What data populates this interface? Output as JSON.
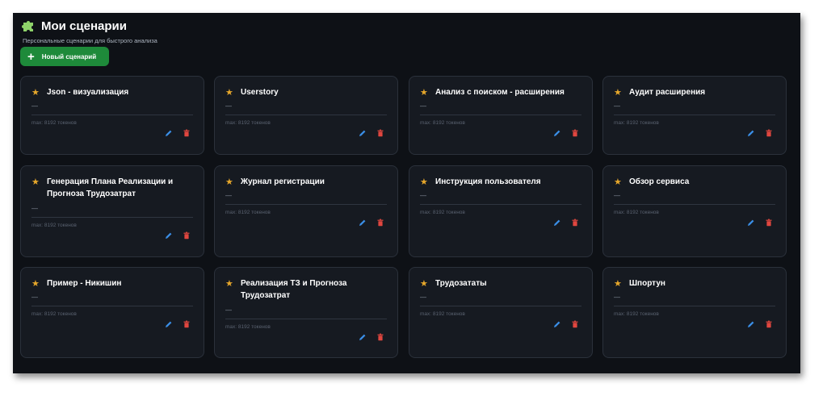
{
  "header": {
    "title": "Мои сценарии",
    "subtitle": "Персональные сценарии для быстрого анализа",
    "new_button_label": "Новый сценарий"
  },
  "cards": [
    {
      "title": "Json - визуализация",
      "description": "—",
      "meta": "max: 8192 токенов"
    },
    {
      "title": "Userstory",
      "description": "—",
      "meta": "max: 8192 токенов"
    },
    {
      "title": "Анализ с поиском - расширения",
      "description": "—",
      "meta": "max: 8192 токенов"
    },
    {
      "title": "Аудит расширения",
      "description": "—",
      "meta": "max: 8192 токенов"
    },
    {
      "title": "Генерация Плана Реализации и Прогноза Трудозатрат",
      "description": "—",
      "meta": "max: 8192 токенов"
    },
    {
      "title": "Журнал регистрации",
      "description": "—",
      "meta": "max: 8192 токенов"
    },
    {
      "title": "Инструкция пользователя",
      "description": "—",
      "meta": "max: 8192 токенов"
    },
    {
      "title": "Обзор сервиса",
      "description": "—",
      "meta": "max: 8192 токенов"
    },
    {
      "title": "Пример - Никишин",
      "description": "—",
      "meta": "max: 8192 токенов"
    },
    {
      "title": "Реализация ТЗ и Прогноза Трудозатрат",
      "description": "—",
      "meta": "max: 8192 токенов"
    },
    {
      "title": "Трудозататы",
      "description": "—",
      "meta": "max: 8192 токенов"
    },
    {
      "title": "Шпортун",
      "description": "—",
      "meta": "max: 8192 токенов"
    }
  ],
  "colors": {
    "background": "#0e1116",
    "card": "#161a21",
    "accent_green": "#1e8a3a",
    "star": "#e6a72b",
    "edit": "#3a8ee6",
    "delete": "#e0463f"
  },
  "icons": {
    "header": "puzzle-icon",
    "favorite": "star-icon",
    "edit": "pencil-icon",
    "delete": "trash-icon",
    "add": "plus-icon"
  }
}
